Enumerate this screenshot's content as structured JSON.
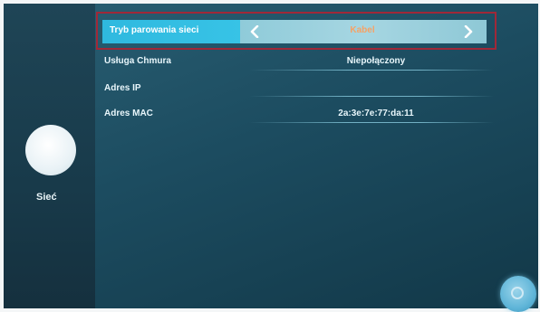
{
  "sidebar": {
    "menu_label": "Sieć"
  },
  "settings": {
    "mode": {
      "label": "Tryb parowania sieci",
      "value": "Kabel"
    },
    "rows": [
      {
        "label": "Usługa Chmura",
        "value": "Niepołączony"
      },
      {
        "label": "Adres IP",
        "value": ""
      },
      {
        "label": "Adres MAC",
        "value": "2a:3e:7e:77:da:11"
      }
    ]
  },
  "colors": {
    "highlight": "#a02838",
    "selected_label_bg": "#37c3e6",
    "value_accent": "#f6a266"
  },
  "icons": {
    "prev": "chevron-left-icon",
    "next": "chevron-right-icon",
    "fab": "circle-button-icon"
  }
}
